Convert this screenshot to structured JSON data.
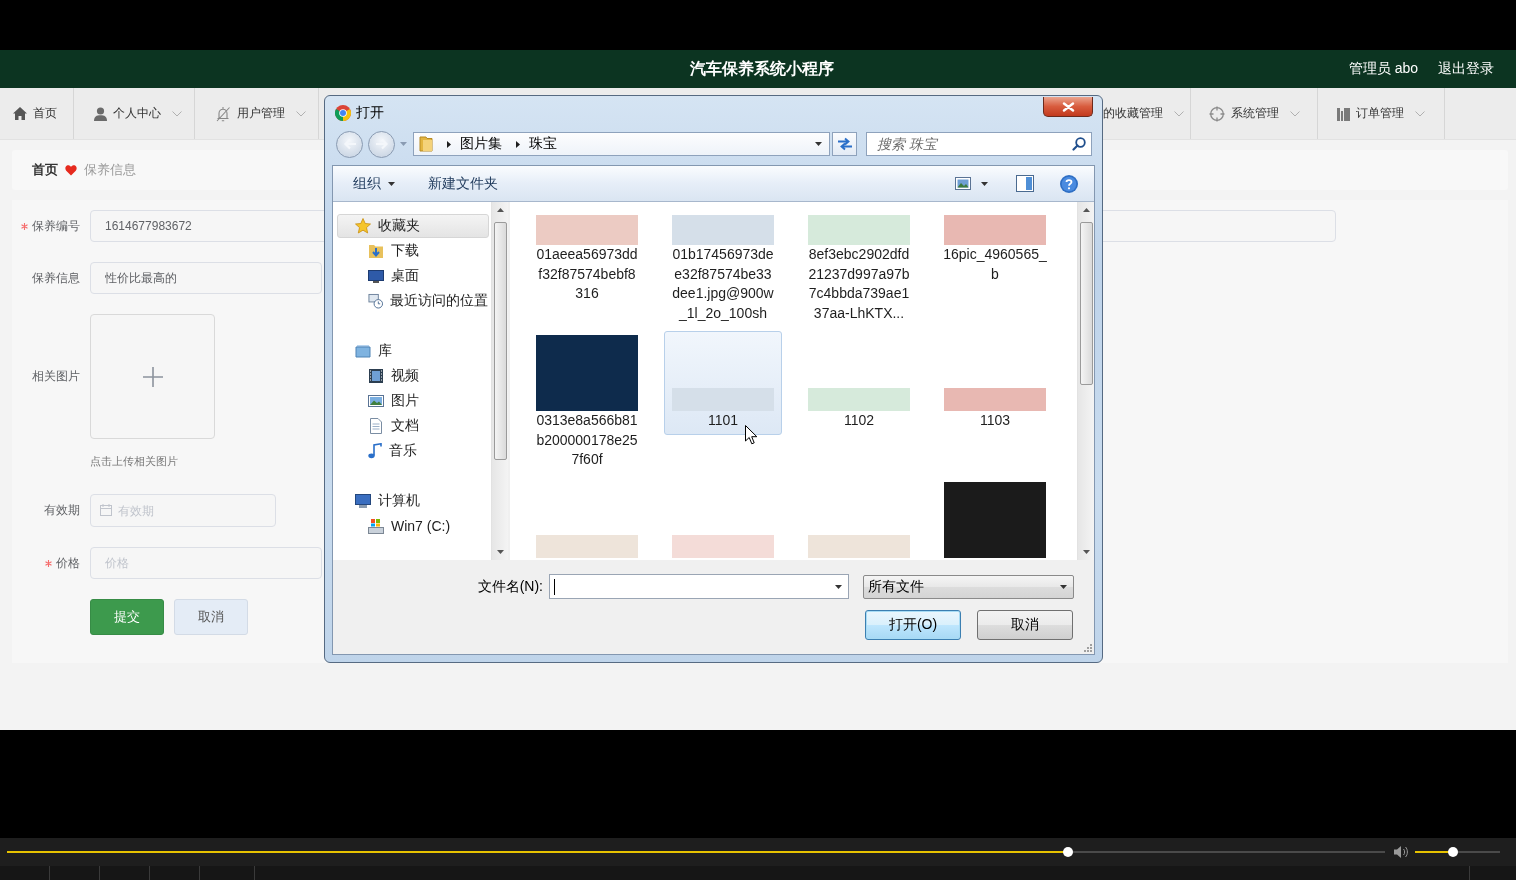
{
  "header": {
    "title": "汽车保养系统小程序",
    "user": "管理员 abo",
    "logout": "退出登录"
  },
  "nav": {
    "left_items": [
      {
        "label": "首页",
        "dropdown": false
      },
      {
        "label": "个人中心",
        "dropdown": true
      },
      {
        "label": "用户管理",
        "dropdown": true
      }
    ],
    "right_items": [
      {
        "label": "的收藏管理",
        "dropdown": true
      },
      {
        "label": "系统管理",
        "dropdown": true
      },
      {
        "label": "订单管理",
        "dropdown": true
      }
    ]
  },
  "breadcrumb": [
    {
      "label": "首页",
      "current": false
    },
    {
      "label": "保养信息",
      "current": true
    }
  ],
  "form": {
    "fields": [
      {
        "kind": "text",
        "label": "保养编号",
        "required": true,
        "value": "1614677983672"
      },
      {
        "kind": "text",
        "label": "保养信息",
        "required": false,
        "value": "性价比最高的"
      },
      {
        "kind": "upload",
        "label": "相关图片",
        "required": false,
        "hint": "点击上传相关图片"
      },
      {
        "kind": "date",
        "label": "有效期",
        "required": false,
        "placeholder": "有效期"
      },
      {
        "kind": "text",
        "label": "价格",
        "required": true,
        "placeholder": "价格"
      }
    ],
    "buttons": [
      {
        "label": "提交",
        "kind": "primary"
      },
      {
        "label": "取消",
        "kind": "secondary"
      }
    ]
  },
  "dialog": {
    "title": "打开",
    "path": [
      "图片集",
      "珠宝"
    ],
    "search": {
      "placeholder": "搜索 珠宝"
    },
    "toolbar": [
      {
        "label": "组织",
        "dropdown": true
      },
      {
        "label": "新建文件夹",
        "dropdown": false
      }
    ],
    "tree": [
      {
        "label": "收藏夹",
        "selected": true,
        "children": [
          {
            "label": "下载",
            "selected": false
          },
          {
            "label": "桌面",
            "selected": false
          },
          {
            "label": "最近访问的位置",
            "selected": false
          }
        ]
      },
      {
        "label": "库",
        "selected": false,
        "children": [
          {
            "label": "视频",
            "selected": false
          },
          {
            "label": "图片",
            "selected": false
          },
          {
            "label": "文档",
            "selected": false
          },
          {
            "label": "音乐",
            "selected": false
          }
        ]
      },
      {
        "label": "计算机",
        "selected": false,
        "children": [
          {
            "label": "Win7 (C:)",
            "selected": false
          }
        ]
      }
    ],
    "files": [
      {
        "name": "01aeea56973ddf32f87574bebf8316",
        "kind": "banner",
        "color": "#eccbc3",
        "selected": false
      },
      {
        "name": "01b17456973dee32f87574be33dee1.jpg@900w_1l_2o_100sh",
        "kind": "banner",
        "color": "#d5dfe9",
        "selected": false
      },
      {
        "name": "8ef3ebc2902dfd21237d997a97b7c4bbda739ae137aa-LhKTX...",
        "kind": "banner",
        "color": "#d6eadb",
        "selected": false
      },
      {
        "name": "16pic_4960565_b",
        "kind": "banner",
        "color": "#e8b8b2",
        "selected": false
      },
      {
        "name": "0313e8a566b81b200000178e257f60f",
        "kind": "tile",
        "color": "#0e2b4c",
        "selected": false
      },
      {
        "name": "1101",
        "kind": "strip",
        "color": "#d5dfe9",
        "selected": true
      },
      {
        "name": "1102",
        "kind": "strip",
        "color": "#d6eadb",
        "selected": false
      },
      {
        "name": "1103",
        "kind": "strip",
        "color": "#e8b8b2",
        "selected": false
      },
      {
        "kind": "strip",
        "color": "#eee4da",
        "selected": false
      },
      {
        "kind": "strip",
        "color": "#f4dcd8",
        "selected": false
      },
      {
        "kind": "strip",
        "color": "#eee4da",
        "selected": false
      },
      {
        "kind": "tile",
        "color": "#1b1b1b",
        "selected": false
      }
    ],
    "filename": {
      "label": "文件名(N):",
      "focused": true
    },
    "filetype": {
      "value": "所有文件"
    },
    "buttons": [
      {
        "label": "打开(O)",
        "default": true
      },
      {
        "label": "取消",
        "default": false
      }
    ]
  },
  "player": {
    "progress": {
      "level": 0.77
    },
    "volume": {
      "level": 0.45
    }
  }
}
